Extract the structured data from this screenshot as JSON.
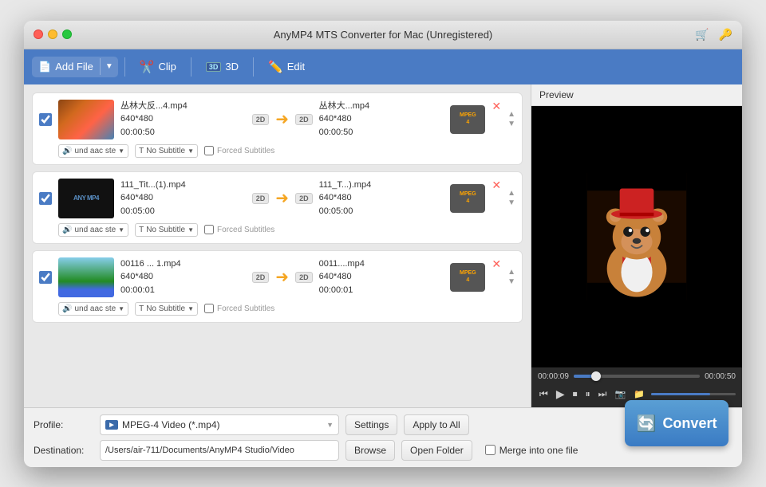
{
  "window": {
    "title": "AnyMP4 MTS Converter for Mac (Unregistered)"
  },
  "toolbar": {
    "add_file": "Add File",
    "clip": "Clip",
    "three_d": "3D",
    "edit": "Edit"
  },
  "files": [
    {
      "id": 1,
      "input_name": "丛林大反...4.mp4",
      "input_size": "640*480",
      "input_duration": "00:00:50",
      "output_name": "丛林大...mp4",
      "output_size": "640*480",
      "output_duration": "00:00:50",
      "audio": "und aac ste",
      "subtitle": "No Subtitle",
      "has_thumb": true,
      "thumb_type": "movie"
    },
    {
      "id": 2,
      "input_name": "111_Tit...(1).mp4",
      "input_size": "640*480",
      "input_duration": "00:05:00",
      "output_name": "111_T...).mp4",
      "output_size": "640*480",
      "output_duration": "00:05:00",
      "audio": "und aac ste",
      "subtitle": "No Subtitle",
      "has_thumb": false,
      "thumb_type": "black"
    },
    {
      "id": 3,
      "input_name": "00116 ... 1.mp4",
      "input_size": "640*480",
      "input_duration": "00:00:01",
      "output_name": "0011....mp4",
      "output_size": "640*480",
      "output_duration": "00:00:01",
      "audio": "und aac ste",
      "subtitle": "No Subtitle",
      "has_thumb": true,
      "thumb_type": "scenery"
    }
  ],
  "preview": {
    "label": "Preview",
    "current_time": "00:00:09",
    "total_time": "00:00:50",
    "progress_pct": 18
  },
  "profile": {
    "label": "Profile:",
    "value": "MPEG-4 Video (*.mp4)",
    "settings_btn": "Settings",
    "apply_btn": "Apply to All"
  },
  "destination": {
    "label": "Destination:",
    "path": "/Users/air-711/Documents/AnyMP4 Studio/Video",
    "browse_btn": "Browse",
    "open_btn": "Open Folder",
    "merge_label": "Merge into one file"
  },
  "convert": {
    "label": "Convert"
  },
  "subtitle_label": "Subtitle",
  "no_subtitle_label": "No Subtitle",
  "forced_subtitles_label": "Forced Subtitles"
}
